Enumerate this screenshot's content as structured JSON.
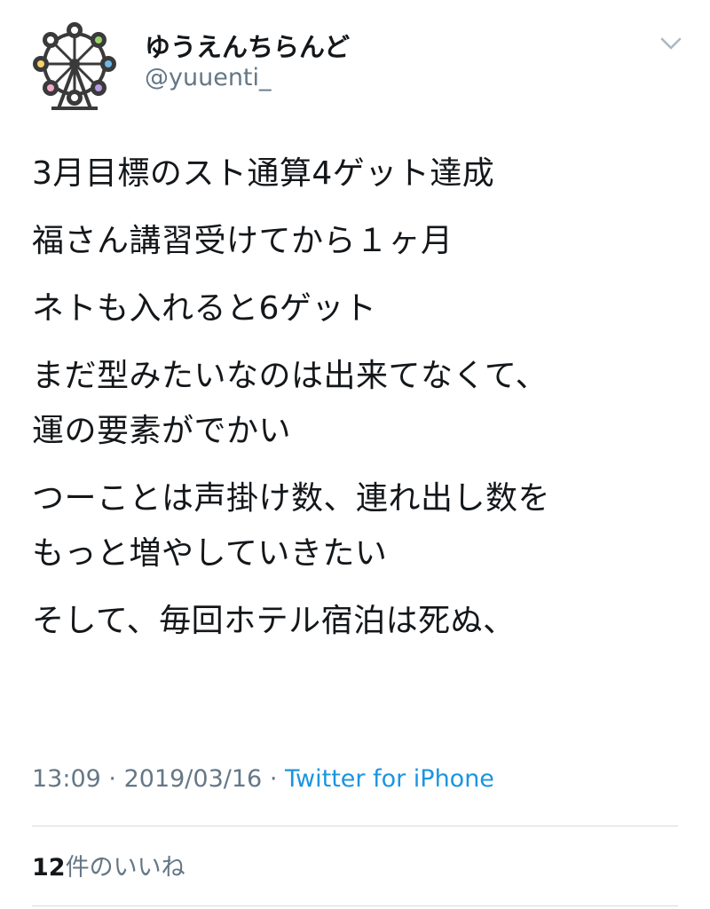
{
  "user": {
    "display_name": "ゆうえんちらんど",
    "handle": "@yuuenti_",
    "avatar_icon": "ferris-wheel-icon"
  },
  "tweet": {
    "paragraphs": [
      "3月目標のスト通算4ゲット達成",
      "福さん講習受けてから１ヶ月",
      "ネトも入れると6ゲット",
      "まだ型みたいなのは出来てなくて、\n運の要素がでかい",
      "つーことは声掛け数、連れ出し数を\nもっと増やしていきたい",
      "そして、毎回ホテル宿泊は死ぬ、"
    ],
    "time": "13:09",
    "separator": "·",
    "date": "2019/03/16",
    "source": "Twitter for iPhone"
  },
  "likes": {
    "count": "12",
    "label": "件のいいね"
  },
  "colors": {
    "text": "#14171a",
    "secondary": "#657786",
    "link": "#1b95e0",
    "divider": "#d6dbe0"
  }
}
